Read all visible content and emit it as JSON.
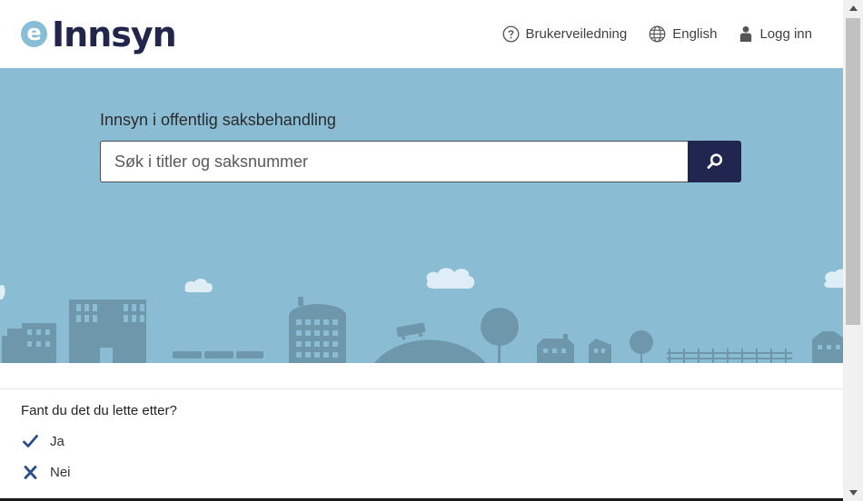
{
  "header": {
    "logo_letter": "e",
    "logo_text": "Innsyn",
    "nav": {
      "help_label": "Brukerveiledning",
      "language_label": "English",
      "login_label": "Logg inn"
    }
  },
  "hero": {
    "title": "Innsyn i offentlig saksbehandling",
    "search_placeholder": "Søk i titler og saksnummer"
  },
  "feedback": {
    "question": "Fant du det du lette etter?",
    "yes_label": "Ja",
    "no_label": "Nei"
  },
  "colors": {
    "hero_bg": "#8abcd4",
    "brand_dark": "#212650",
    "logo_circle": "#87bdd5",
    "skyline": "#6f97ac"
  },
  "icons": [
    "help-circle-icon",
    "globe-icon",
    "user-icon",
    "search-icon",
    "check-icon",
    "x-icon"
  ]
}
